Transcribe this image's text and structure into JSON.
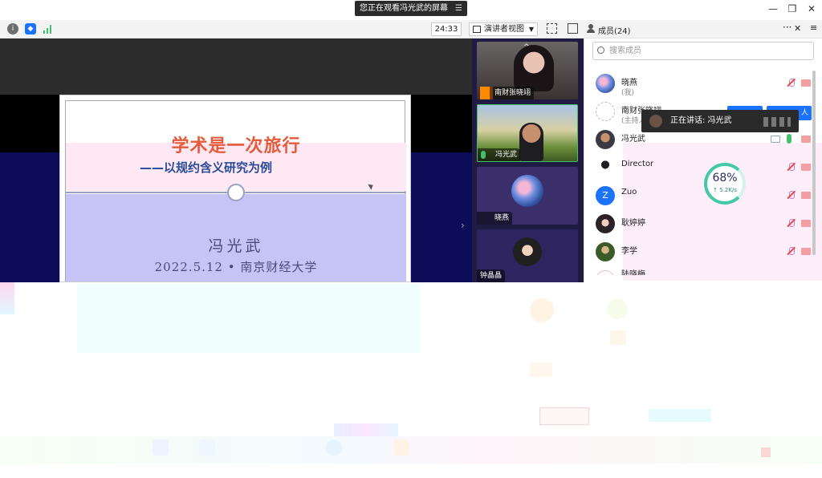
{
  "banner": {
    "text": "您正在观看冯光武的屏幕",
    "menu_icon": "hamburger-icon"
  },
  "window": {
    "minimize": "—",
    "restore": "❐",
    "close": "✕"
  },
  "toolbar": {
    "timer": "24:33",
    "view_mode": "演讲者视图",
    "colors": {
      "info": "#6d6d6d",
      "shield": "#1a72ff",
      "signal": "#43c06a"
    }
  },
  "members": {
    "title": "成员(24)",
    "search_placeholder": "搜索成员",
    "list": [
      {
        "name": "晓燕",
        "sub": "(我)"
      },
      {
        "name": "南财张晓翊",
        "sub": "(主持人)"
      },
      {
        "name": "冯光武",
        "sub": ""
      },
      {
        "name": "Director",
        "sub": ""
      },
      {
        "name": "Zuo",
        "sub": ""
      },
      {
        "name": "耿婷婷",
        "sub": ""
      },
      {
        "name": "李学",
        "sub": ""
      },
      {
        "name": "陆晓梅",
        "sub": ""
      }
    ]
  },
  "toast": {
    "text": "正在讲话: 冯光武"
  },
  "host_buttons": {
    "left": "",
    "right": "人"
  },
  "gauge": {
    "percent": "68%",
    "speed": "↑ 5.2K/s"
  },
  "slide": {
    "title": "学术是一次旅行",
    "subtitle": "——以规约含义研究为例",
    "author": "冯光武",
    "date": "2022.5.12 • 南京财经大学"
  },
  "videos": [
    {
      "name": "南财张晓翊"
    },
    {
      "name": "冯光武"
    },
    {
      "name": "晓燕"
    },
    {
      "name": "钟晶晶"
    }
  ],
  "avatar_letter": "Z"
}
